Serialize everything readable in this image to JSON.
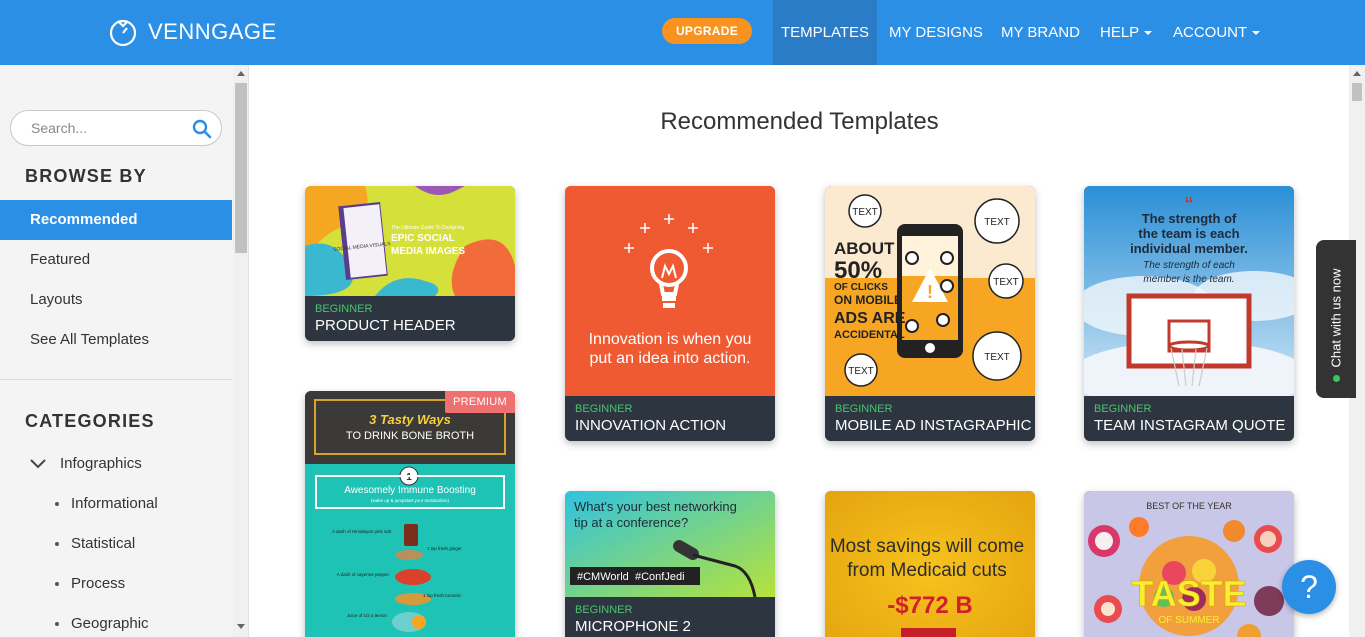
{
  "header": {
    "logo_text": "VENNGAGE",
    "upgrade_label": "UPGRADE",
    "nav": [
      {
        "label": "TEMPLATES"
      },
      {
        "label": "MY DESIGNS"
      },
      {
        "label": "MY BRAND"
      },
      {
        "label": "HELP"
      },
      {
        "label": "ACCOUNT"
      }
    ]
  },
  "sidebar": {
    "search_placeholder": "Search...",
    "browse_heading": "BROWSE BY",
    "browse_items": [
      {
        "label": "Recommended"
      },
      {
        "label": "Featured"
      },
      {
        "label": "Layouts"
      },
      {
        "label": "See All Templates"
      }
    ],
    "categories_heading": "CATEGORIES",
    "category": "Infographics",
    "subcategories": [
      {
        "label": "Informational"
      },
      {
        "label": "Statistical"
      },
      {
        "label": "Process"
      },
      {
        "label": "Geographic"
      }
    ]
  },
  "main": {
    "title": "Recommended Templates",
    "cards": [
      {
        "level": "BEGINNER",
        "name": "PRODUCT HEADER"
      },
      {
        "level": "BEGINNER",
        "name": "INNOVATION ACTION"
      },
      {
        "level": "BEGINNER",
        "name": "MOBILE AD INSTAGRAPHIC"
      },
      {
        "level": "BEGINNER",
        "name": "TEAM INSTAGRAM QUOTE"
      },
      {
        "badge": "PREMIUM"
      },
      {
        "level": "BEGINNER",
        "name": "MICROPHONE 2"
      },
      {},
      {}
    ],
    "thumbs": {
      "product_header": {
        "line1": "The Ultimate Guide To Designing",
        "line2": "EPIC SOCIAL",
        "line3": "MEDIA IMAGES",
        "book": "SOCIAL MEDIA VISUALS"
      },
      "innovation": {
        "line1": "Innovation is when you",
        "line2": "put an idea into action."
      },
      "mobile_ad": {
        "about": "ABOUT",
        "pct": "50%",
        "l1": "OF CLICKS",
        "l2": "ON MOBILE",
        "l3": "ADS ARE",
        "l4": "ACCIDENTAL",
        "bubble": "TEXT"
      },
      "team_quote": {
        "q1": "The strength of",
        "q2": "the team is each",
        "q3": "individual member.",
        "s1": "The strength of each",
        "s2": "member is the team."
      },
      "bone_broth": {
        "t1": "3 Tasty Ways",
        "t2": "TO DRINK BONE BROTH",
        "num": "1",
        "b1": "Awesomely Immune Boosting",
        "b2": "(wake up & jumpstart your metabolism)",
        "i1": "A dash of Himalayan pink salt",
        "i2": "1 tsp fresh ginger",
        "i3": "A dash of cayenne pepper",
        "i4": "1 tsp fresh turmeric",
        "i5": "Juice of 1/2 a lemon"
      },
      "microphone": {
        "q1": "What's your best networking",
        "q2": "tip at a conference?",
        "tag1": "#CMWorld",
        "tag2": "#ConfJedi"
      },
      "medicaid": {
        "l1": "Most savings will come",
        "l2": "from Medicaid cuts",
        "amount": "-$772 B"
      },
      "taste": {
        "top": "BEST OF THE YEAR",
        "main": "TASTE",
        "sub": "OF SUMMER"
      }
    }
  },
  "chat": {
    "label": "Chat with us now"
  },
  "help": {
    "label": "?"
  }
}
